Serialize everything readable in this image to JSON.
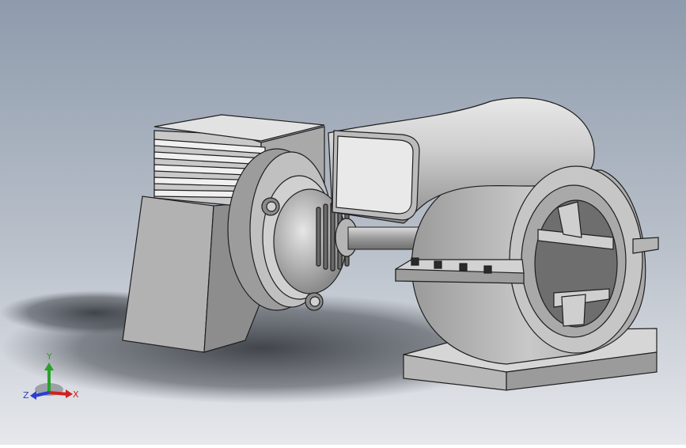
{
  "viewport": {
    "background_top": "#8f9cad",
    "background_bottom": "#e4e6ea",
    "model_shade_light": "#dcdcdc",
    "model_shade_mid": "#b8b8b8",
    "model_shade_dark": "#7a7a7a",
    "edge_color": "#1f1f1f",
    "shadow_color": "#3d4147"
  },
  "triad": {
    "y_label": "Y",
    "x_label": "X",
    "z_label": "Z",
    "x_color": "#d21f1f",
    "y_color": "#2aa12a",
    "z_color": "#2a3fcc"
  }
}
